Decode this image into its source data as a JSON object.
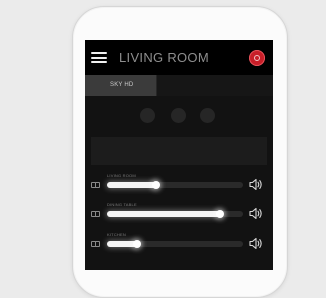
{
  "header": {
    "menu_icon": "hamburger-menu-icon",
    "title": "LIVING ROOM",
    "power_icon": "power-icon",
    "power_color": "#c81e28"
  },
  "tabs": [
    {
      "label": "SKY HD",
      "active": true
    }
  ],
  "source_dots": 3,
  "volume_rows": [
    {
      "label": "LIVING ROOM",
      "level": 0.36
    },
    {
      "label": "DINING TABLE",
      "level": 0.83
    },
    {
      "label": "KITCHEN",
      "level": 0.22
    }
  ],
  "colors": {
    "background": "#121212",
    "accent": "#f4f4f4"
  }
}
